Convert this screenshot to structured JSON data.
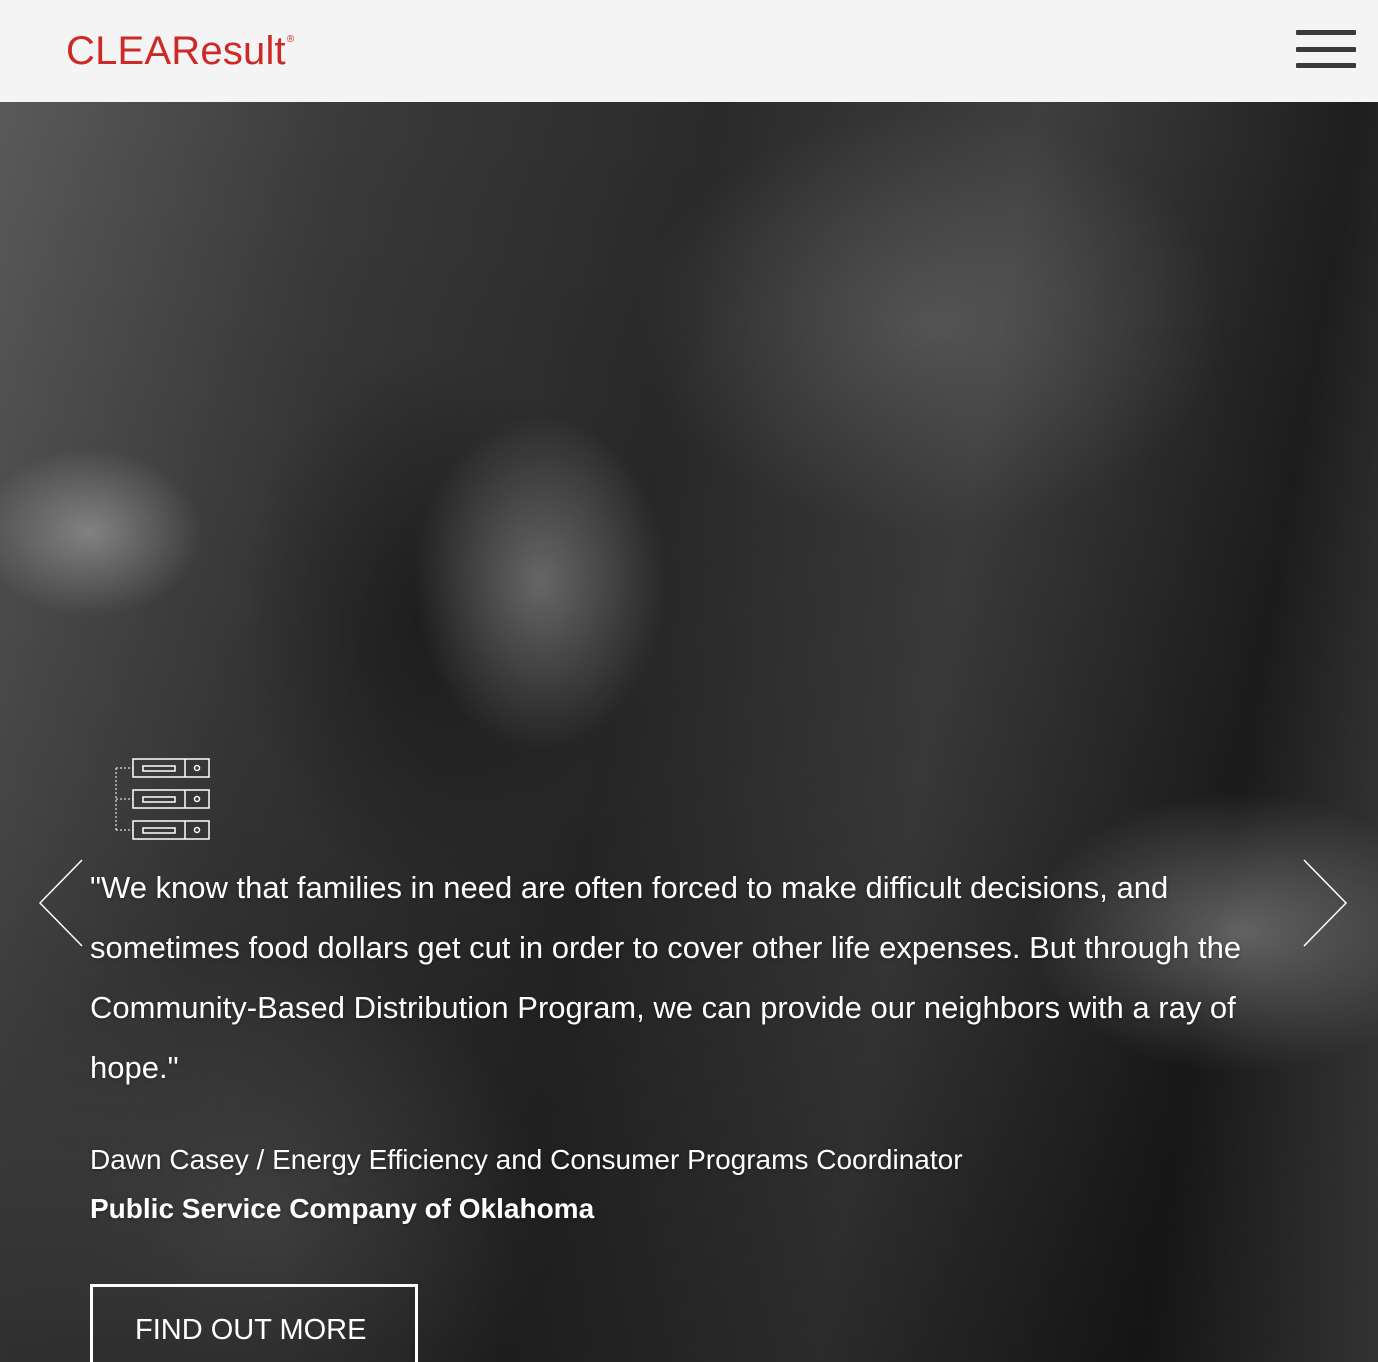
{
  "brand": {
    "name": "CLEAResult",
    "registered_mark": "®",
    "color": "#cc2a26"
  },
  "header": {
    "background": "#f4f4f4",
    "menu_icon": "hamburger-icon"
  },
  "hero": {
    "quote": "\"We know that families in need are often forced to make difficult decisions, and sometimes food dollars get cut in order to cover other life expenses. But through the Community-Based Distribution Program, we can provide our neighbors with a ray of hope.\"",
    "attribution": "Dawn Casey / Energy Efficiency and Consumer Programs Coordinator",
    "company": "Public Service Company of Oklahoma",
    "cta_label": "FIND OUT MORE",
    "icon": "server-stack-icon",
    "prev_icon": "chevron-left-icon",
    "next_icon": "chevron-right-icon"
  }
}
